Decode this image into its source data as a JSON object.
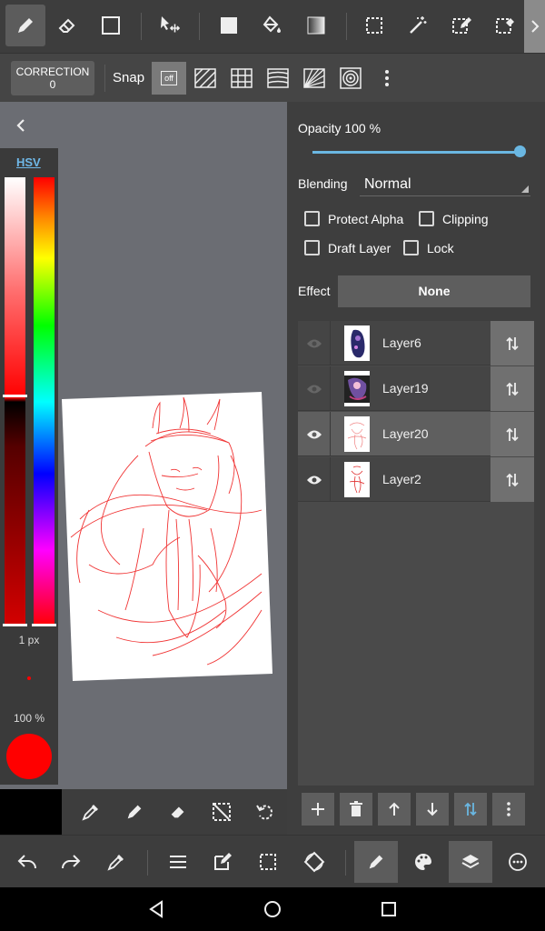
{
  "toolbar": {
    "tools": [
      "pen-tool",
      "eraser-tool",
      "shape-tool",
      "move-tool",
      "fill-color-tool",
      "bucket-tool",
      "gradient-tool",
      "selection-tool",
      "magic-wand-tool",
      "selection-pen-tool",
      "selection-eraser-tool"
    ]
  },
  "subbar": {
    "correction_label": "CORRECTION",
    "correction_value": "0",
    "snap_label": "Snap",
    "snap_off_label": "off"
  },
  "palette": {
    "mode_tab": "HSV",
    "brush_size": "1 px",
    "brush_opacity": "100 %",
    "current_color": "#ff0000"
  },
  "layer_panel": {
    "opacity_label": "Opacity 100 %",
    "opacity_value": 1.0,
    "blending_label": "Blending",
    "blending_value": "Normal",
    "protect_alpha_label": "Protect Alpha",
    "clipping_label": "Clipping",
    "draft_layer_label": "Draft Layer",
    "lock_label": "Lock",
    "effect_label": "Effect",
    "effect_value": "None",
    "layers": [
      {
        "name": "Layer6",
        "visible": false,
        "selected": false
      },
      {
        "name": "Layer19",
        "visible": false,
        "selected": false
      },
      {
        "name": "Layer20",
        "visible": true,
        "selected": true
      },
      {
        "name": "Layer2",
        "visible": true,
        "selected": false
      }
    ]
  },
  "colors": {
    "accent": "#6ab7e2",
    "toolbar_bg": "#3d3d3d",
    "canvas_bg": "#6b6d73",
    "brush": "#ff0000"
  }
}
